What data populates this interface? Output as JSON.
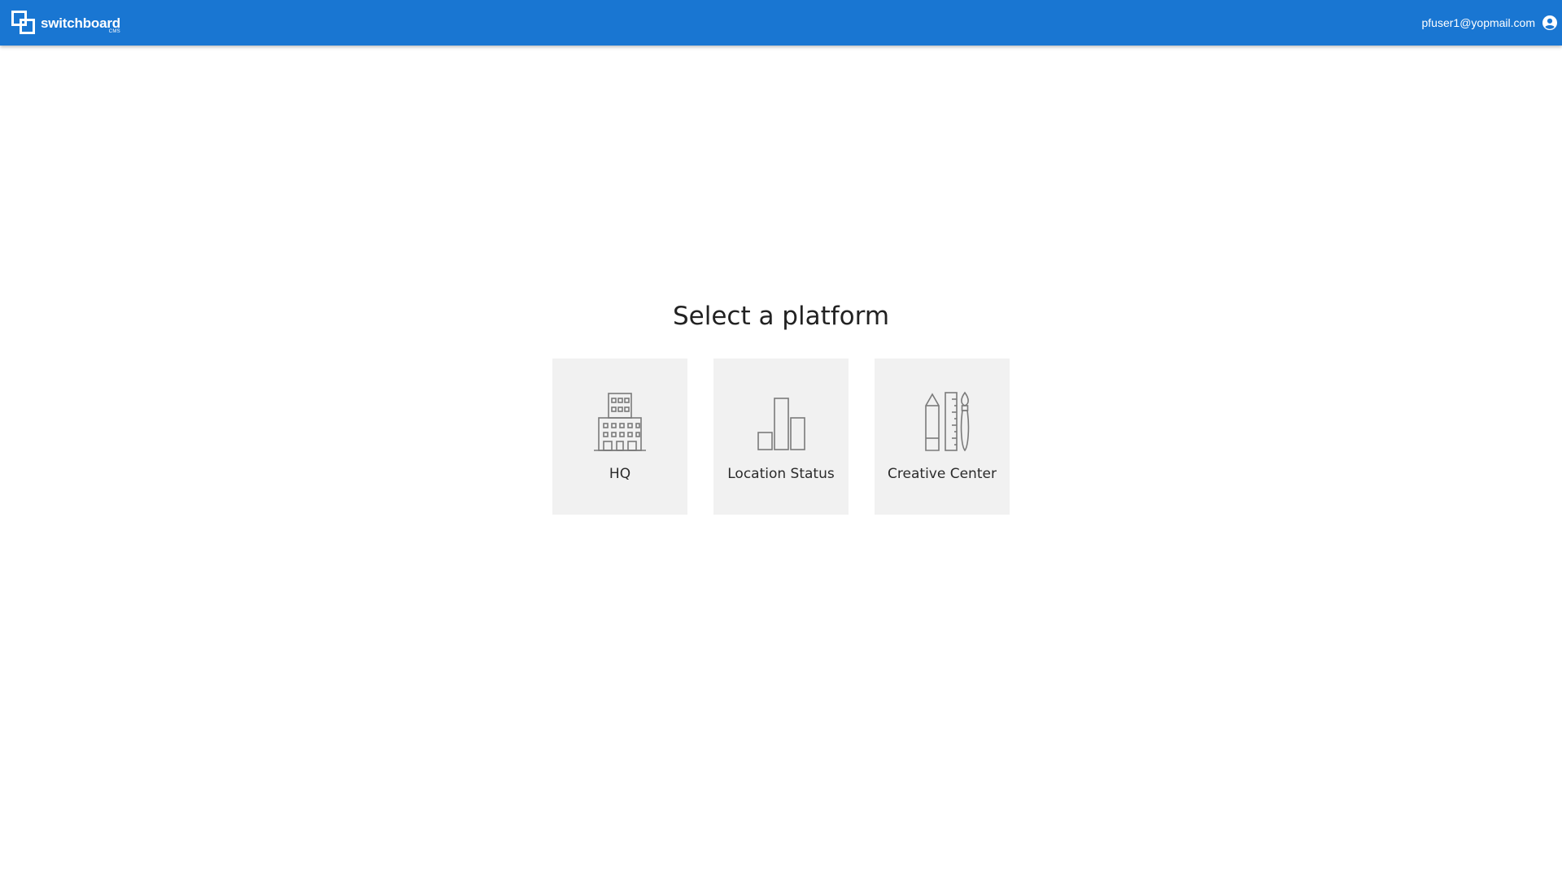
{
  "header": {
    "brand_name": "switchboard",
    "brand_sub": "CMS",
    "user_email": "pfuser1@yopmail.com",
    "background_color": "#1976d2",
    "logo_icon": "overlapping-squares-icon",
    "user_icon": "account-circle-icon"
  },
  "main": {
    "title": "Select a platform",
    "platforms": [
      {
        "label": "HQ",
        "icon": "building-icon"
      },
      {
        "label": "Location Status",
        "icon": "bar-chart-icon"
      },
      {
        "label": "Creative Center",
        "icon": "design-tools-icon"
      }
    ],
    "card_background": "#f1f1f1"
  }
}
